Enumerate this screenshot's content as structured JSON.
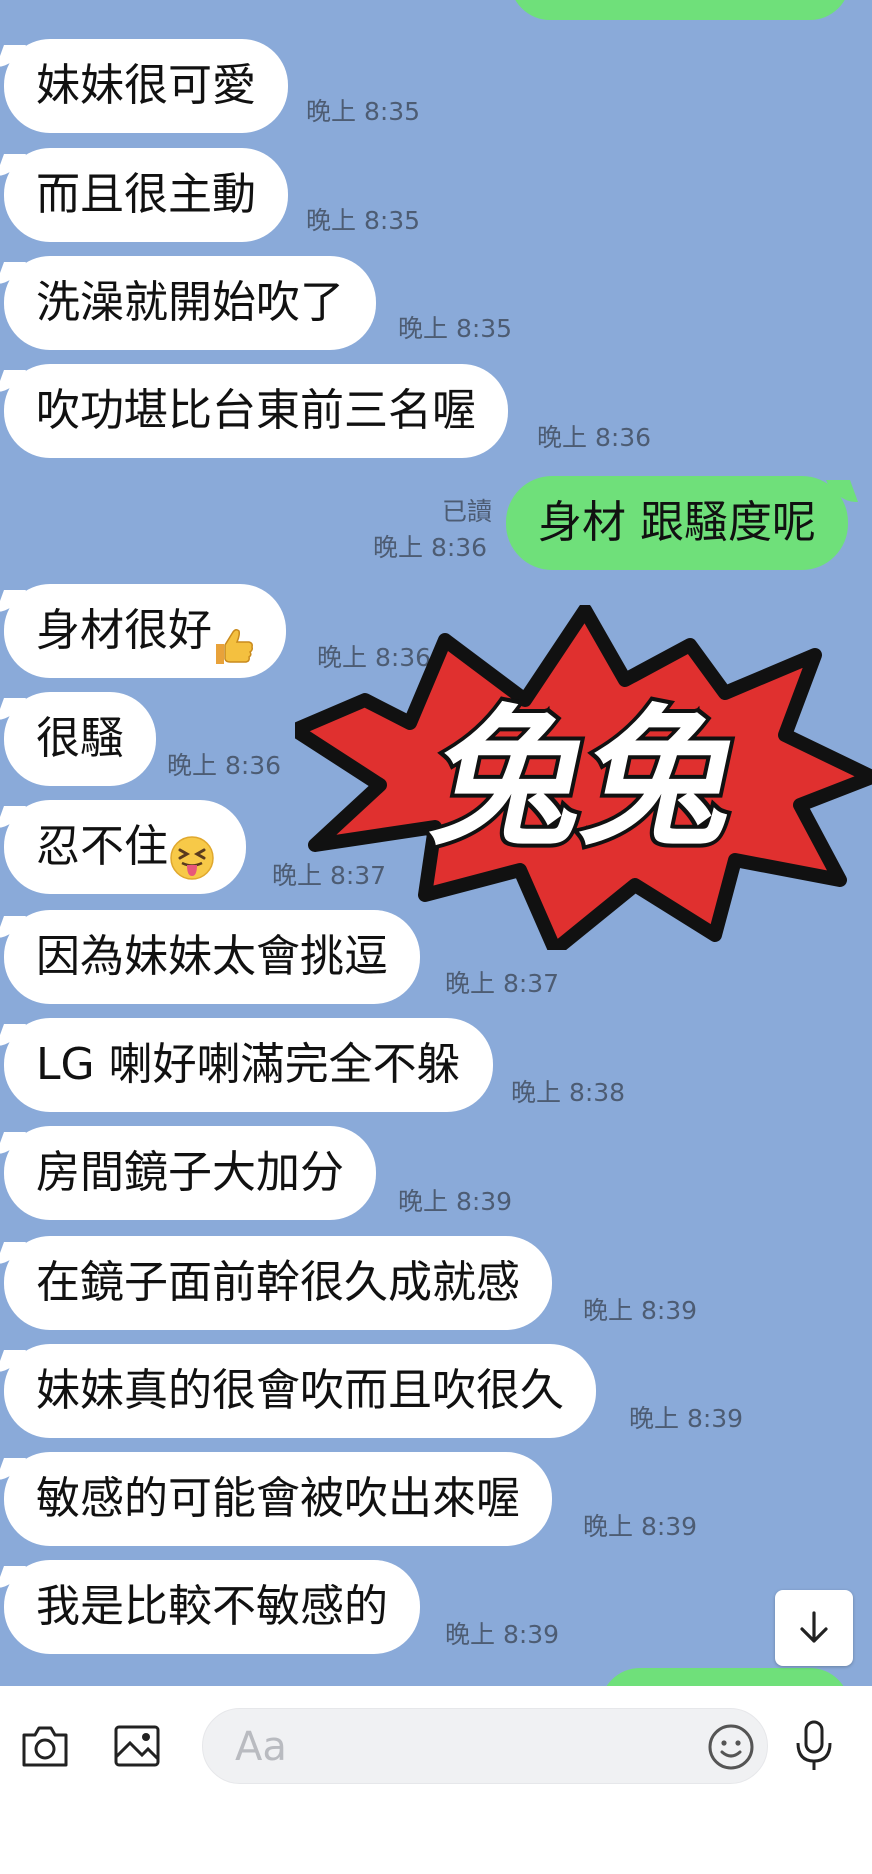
{
  "colors": {
    "chat_bg": "#8aaad9",
    "incoming_bubble": "#ffffff",
    "outgoing_bubble": "#6fe07a",
    "sticker_red": "#e0302f"
  },
  "messages": [
    {
      "text": "妹妹很可愛",
      "time": "晚上 8:35"
    },
    {
      "text": "而且很主動",
      "time": "晚上 8:35"
    },
    {
      "text": "洗澡就開始吹了",
      "time": "晚上 8:35"
    },
    {
      "text": "吹功堪比台東前三名喔",
      "time": "晚上 8:36"
    },
    {
      "text": "身材 跟騷度呢",
      "time": "晚上 8:36",
      "read": "已讀",
      "outgoing": true
    },
    {
      "text": "身材很好",
      "time": "晚上 8:36",
      "emoji": "thumbs-up"
    },
    {
      "text": "很騷",
      "time": "晚上 8:36"
    },
    {
      "text": "忍不住",
      "time": "晚上 8:37",
      "emoji": "tongue-out-face"
    },
    {
      "text": "因為妹妹太會挑逗",
      "time": "晚上 8:37"
    },
    {
      "text": "LG 喇好喇滿完全不躲",
      "time": "晚上 8:38"
    },
    {
      "text": "房間鏡子大加分",
      "time": "晚上 8:39"
    },
    {
      "text": "在鏡子面前幹很久成就感",
      "time": "晚上 8:39"
    },
    {
      "text": "妹妹真的很會吹而且吹很久",
      "time": "晚上 8:39"
    },
    {
      "text": "敏感的可能會被吹出來喔",
      "time": "晚上 8:39"
    },
    {
      "text": "我是比較不敏感的",
      "time": "晚上 8:39"
    }
  ],
  "sticker": {
    "text": "兔兔"
  },
  "input_bar": {
    "placeholder": "Aa"
  },
  "icons": {
    "camera": "camera-icon",
    "image": "image-icon",
    "emoji": "emoji-icon",
    "mic": "microphone-icon",
    "scroll": "arrow-down-icon"
  }
}
